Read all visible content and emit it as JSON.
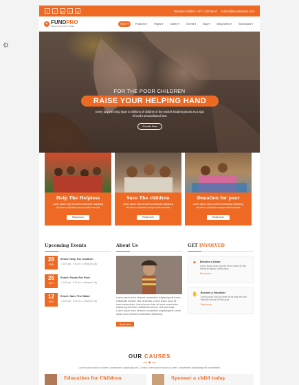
{
  "brand": {
    "name_a": "FUND",
    "name_b": "PRO",
    "tagline": "Helping & Giving NGO Template",
    "accent": "#ee6a24"
  },
  "topbar": {
    "social_icons": [
      "facebook-icon",
      "twitter-icon",
      "google-plus-icon",
      "linkedin-icon",
      "instagram-icon"
    ],
    "social_glyphs": [
      "f",
      "t",
      "g+",
      "in",
      "ig"
    ],
    "hotline": "Donation Hotline: +87 1 223 3444",
    "email": "contact@yourdomain.com"
  },
  "nav": {
    "items": [
      "Home",
      "Features",
      "Pages",
      "Gallery",
      "Events",
      "Blog",
      "Mega Menu",
      "Shortcodes"
    ],
    "active": "Home"
  },
  "hero": {
    "subtitle": "FOR THE POOR CHILDREN",
    "title": "RAISE YOUR HELPING HAND",
    "text": "Every day we bring hope to millions of children in the world's hardest places as a sign of God's unconditional love.",
    "button": "Donate Now"
  },
  "cards": [
    {
      "title": "Help The Helpless",
      "text": "Lorem ipsum dolor sit amet consectetur adipiscing elit donec sollicitudin semper velit venenatis",
      "button": "Read more"
    },
    {
      "title": "Save The children",
      "text": "Lorem ipsum dolor sit amet consectetur adipiscing elit donec sollicitudin semper velit venenatis",
      "button": "Read more"
    },
    {
      "title": "Donation for poor",
      "text": "Lorem ipsum dolor sit amet consectetur adipiscing elit donec sollicitudin semper velit venenatis",
      "button": "Read more"
    }
  ],
  "events": {
    "title": "Upcoming Events",
    "items": [
      {
        "day": "28",
        "month": "FEB",
        "title": "Event: Help The Children",
        "time": "5.00 pm - 9.00 pm",
        "place": "Newyork City"
      },
      {
        "day": "26",
        "month": "OCT",
        "title": "Event: Foods For Poor",
        "time": "5.00 pm - 9.00 pm",
        "place": "Newyork City"
      },
      {
        "day": "12",
        "month": "DEC",
        "title": "Event: Save The Water",
        "time": "5.00 pm - 9.00 pm",
        "place": "Newyork City"
      }
    ]
  },
  "about": {
    "title": "About Us",
    "text": "Lorem ipsum dolor sit amet consectetur adipiscing elit donec sollicitudin semper velit venenatis. Lorem ipsum dolor sit amet consectetur. Lorem ipsum dolor sit amet consectetur adipiscing elit donec sollicitudin semper velit venenatis. Lorem ipsum dolor sit amet consectetur adipiscing elit Lorem ipsum dolor sit amet consectetur adipiscing.",
    "button": "Read more"
  },
  "involved": {
    "title_a": "GET ",
    "title_b": "INVOLVED",
    "items": [
      {
        "title": "Become a Donar",
        "text": "Lorem ipsum dolor sit amet elit sit amet elit velit helpfully helping. Mollita quas.",
        "more": "Read more...",
        "icon": "donor-hand-icon"
      },
      {
        "title": "Become a Volunteer",
        "text": "Lorem ipsum dolor sit amet elit sit amet elit velit helpfully helping. Mollita quas.",
        "more": "Read more...",
        "icon": "volunteer-hand-icon"
      }
    ]
  },
  "our_causes": {
    "title_a": "OUR ",
    "title_b": "CAUSES",
    "text": "Lorem ipsum dolor sit amet, consectetur adipiscing elit. Donec Lorem ipsum dolor sit amet, consectetur adipiscing elit consectetur",
    "items": [
      {
        "title": "Education for Children"
      },
      {
        "title": "Sponsor a child today"
      }
    ]
  }
}
